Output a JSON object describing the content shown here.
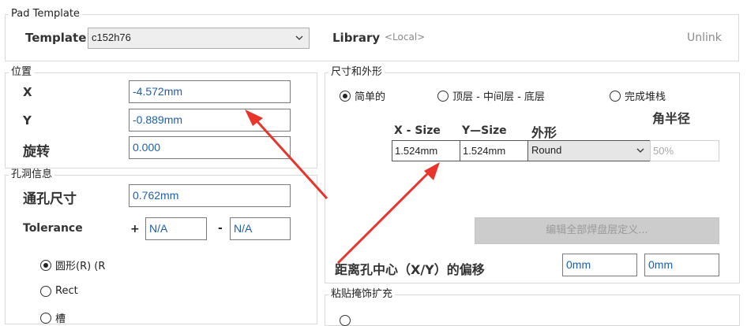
{
  "pad_template": {
    "legend": "Pad Template",
    "template_label": "Template",
    "template_value": "c152h76",
    "library_label": "Library",
    "library_value": "<Local>",
    "unlink_label": "Unlink"
  },
  "position": {
    "legend": "位置",
    "x_label": "X",
    "x_value": "-4.572mm",
    "y_label": "Y",
    "y_value": "-0.889mm",
    "rotation_label": "旋转",
    "rotation_value": "0.000"
  },
  "hole_info": {
    "legend": "孔洞信息",
    "hole_size_label": "通孔尺寸",
    "hole_size_value": "0.762mm",
    "tolerance_label": "Tolerance",
    "plus_sign": "+",
    "plus_value": "N/A",
    "minus_sign": "-",
    "minus_value": "N/A",
    "shapes": [
      {
        "label": "圆形(R) (R",
        "selected": true
      },
      {
        "label": "Rect",
        "selected": false
      },
      {
        "label": "槽",
        "selected": false
      }
    ]
  },
  "size_shape": {
    "legend": "尺寸和外形",
    "modes": [
      {
        "label": "简单的",
        "selected": true
      },
      {
        "label": "顶层 - 中间层 - 底层",
        "selected": false
      },
      {
        "label": "完成堆栈",
        "selected": false
      }
    ],
    "corner_radius_label": "角半径",
    "col_xsize": "X - Size",
    "col_ysize": "Y—Size",
    "col_shape": "外形",
    "xsize_value": "1.524mm",
    "ysize_value": "1.524mm",
    "shape_value": "Round",
    "corner_value": "50%",
    "edit_button": "编辑全部焊盘层定义...",
    "offset_label": "距离孔中心（X/Y）的偏移",
    "offset_x": "0mm",
    "offset_y": "0mm"
  },
  "paste_mask": {
    "legend": "粘贴掩饰扩充"
  },
  "colors": {
    "arrow": "#e8342a",
    "value_text": "#1f5fa8",
    "disabled_button": "#cccccc"
  }
}
